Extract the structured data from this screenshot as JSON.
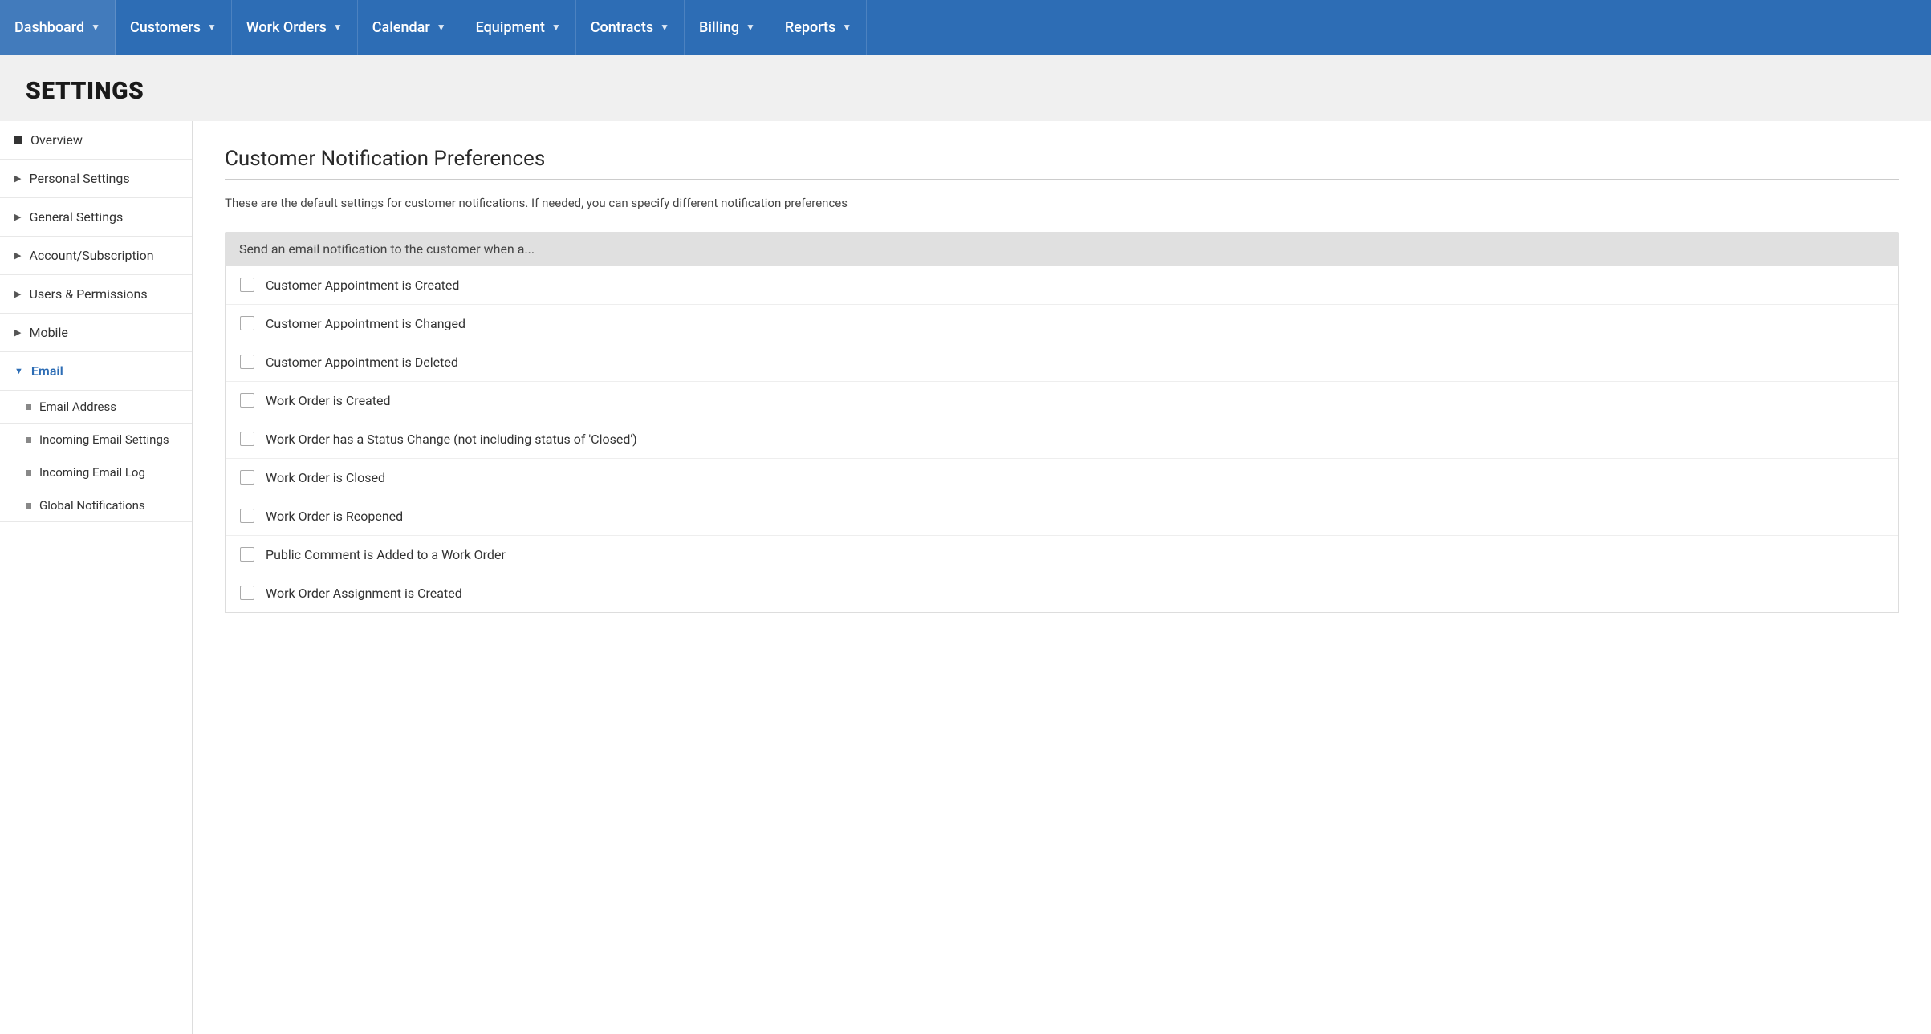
{
  "nav": {
    "items": [
      {
        "label": "Dashboard",
        "key": "dashboard"
      },
      {
        "label": "Customers",
        "key": "customers"
      },
      {
        "label": "Work Orders",
        "key": "work-orders"
      },
      {
        "label": "Calendar",
        "key": "calendar"
      },
      {
        "label": "Equipment",
        "key": "equipment"
      },
      {
        "label": "Contracts",
        "key": "contracts"
      },
      {
        "label": "Billing",
        "key": "billing"
      },
      {
        "label": "Reports",
        "key": "reports"
      }
    ]
  },
  "page": {
    "title": "SETTINGS"
  },
  "sidebar": {
    "items": [
      {
        "label": "Overview",
        "type": "bullet",
        "key": "overview"
      },
      {
        "label": "Personal Settings",
        "type": "arrow",
        "key": "personal-settings"
      },
      {
        "label": "General Settings",
        "type": "arrow",
        "key": "general-settings"
      },
      {
        "label": "Account/Subscription",
        "type": "arrow",
        "key": "account-subscription"
      },
      {
        "label": "Users & Permissions",
        "type": "arrow",
        "key": "users-permissions"
      },
      {
        "label": "Mobile",
        "type": "arrow",
        "key": "mobile"
      },
      {
        "label": "Email",
        "type": "arrow-down",
        "key": "email",
        "active": true
      }
    ],
    "sub_items": [
      {
        "label": "Email Address",
        "key": "email-address"
      },
      {
        "label": "Incoming Email Settings",
        "key": "incoming-email-settings"
      },
      {
        "label": "Incoming Email Log",
        "key": "incoming-email-log"
      },
      {
        "label": "Global Notifications",
        "key": "global-notifications"
      }
    ]
  },
  "main": {
    "section_title": "Customer Notification Preferences",
    "description": "These are the default settings for customer notifications. If needed, you can specify different notification preferences",
    "table_header": "Send an email notification to the customer when a...",
    "notifications": [
      {
        "label": "Customer Appointment is Created",
        "key": "appt-created",
        "checked": false
      },
      {
        "label": "Customer Appointment is Changed",
        "key": "appt-changed",
        "checked": false
      },
      {
        "label": "Customer Appointment is Deleted",
        "key": "appt-deleted",
        "checked": false
      },
      {
        "label": "Work Order is Created",
        "key": "wo-created",
        "checked": false
      },
      {
        "label": "Work Order has a Status Change (not including status of 'Closed')",
        "key": "wo-status-change",
        "checked": false
      },
      {
        "label": "Work Order is Closed",
        "key": "wo-closed",
        "checked": false
      },
      {
        "label": "Work Order is Reopened",
        "key": "wo-reopened",
        "checked": false
      },
      {
        "label": "Public Comment is Added to a Work Order",
        "key": "wo-comment-added",
        "checked": false
      },
      {
        "label": "Work Order Assignment is Created",
        "key": "wo-assignment-created",
        "checked": false
      }
    ]
  }
}
